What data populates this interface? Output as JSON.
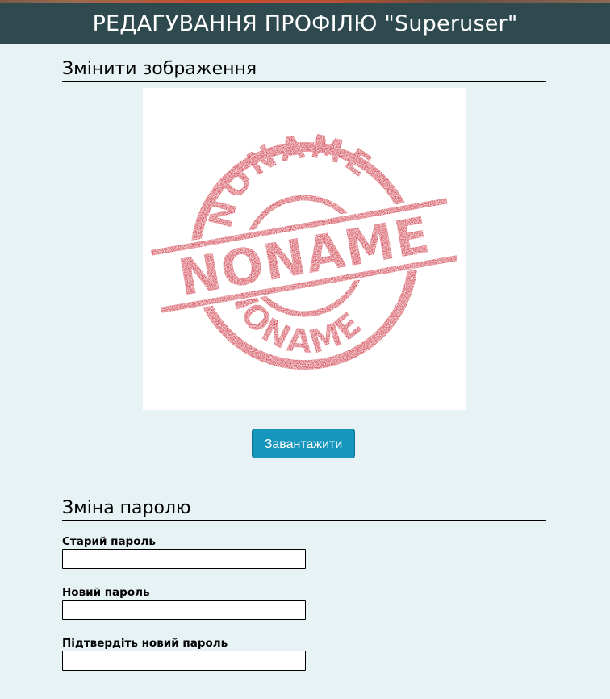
{
  "header": {
    "title": "РЕДАГУВАННЯ ПРОФІЛЮ \"Superuser\""
  },
  "image_section": {
    "heading": "Змінити зображення",
    "avatar": {
      "stamp_text_large": "NONAME",
      "stamp_text_arc_top": "NONAME",
      "stamp_text_arc_bottom": "NONAME"
    },
    "upload_button_label": "Завантажити"
  },
  "password_section": {
    "heading": "Зміна паролю",
    "fields": [
      {
        "label": "Старий пароль",
        "value": ""
      },
      {
        "label": "Новий пароль",
        "value": ""
      },
      {
        "label": "Підтвердіть новий пароль",
        "value": ""
      }
    ]
  },
  "colors": {
    "header_bg": "#2f4a4f",
    "page_bg": "#e7f2f5",
    "button_bg": "#1696bd",
    "stamp_red": "#c8202e"
  }
}
